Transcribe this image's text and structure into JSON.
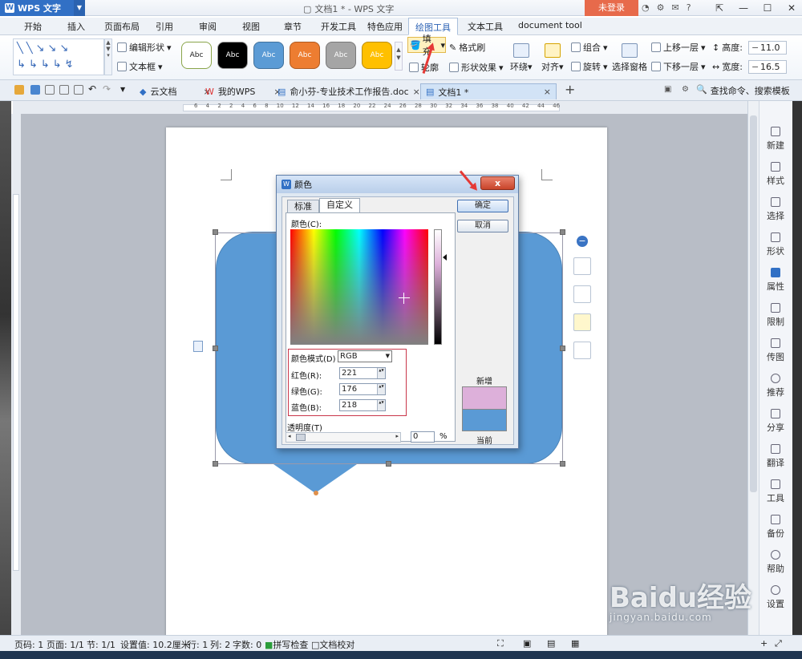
{
  "titlebar": {
    "app_name": "WPS 文字",
    "doc_title": "文档1 * - WPS 文字",
    "login": "未登录"
  },
  "menu": {
    "tabs": [
      "开始",
      "插入",
      "页面布局",
      "引用",
      "审阅",
      "视图",
      "章节",
      "开发工具",
      "特色应用",
      "绘图工具",
      "文本工具",
      "document tool"
    ],
    "active": "绘图工具"
  },
  "ribbon": {
    "edit_shape": "编辑形状",
    "textbox": "文本框",
    "style_label": "Abc",
    "fill": "填充",
    "format_painter": "格式刷",
    "outline": "轮廓",
    "shape_effects": "形状效果",
    "wrap": "环绕",
    "align": "对齐",
    "group": "组合",
    "rotate": "旋转",
    "selection_pane": "选择窗格",
    "bring_forward": "上移一层",
    "send_backward": "下移一层",
    "height_label": "高度:",
    "height_value": "11.0",
    "width_label": "宽度:",
    "width_value": "16.5",
    "style_colors": [
      "#ffffff",
      "#000000",
      "#5b9bd5",
      "#ed7d31",
      "#a5a5a5",
      "#ffc000"
    ]
  },
  "doc_tabs": {
    "items": [
      {
        "label": "云文档",
        "icon": "cloud-doc-icon"
      },
      {
        "label": "我的WPS",
        "icon": "wps-logo-icon"
      },
      {
        "label": "俞小芬-专业技术工作报告.doc",
        "icon": "doc-file-icon"
      },
      {
        "label": "文档1 *",
        "icon": "doc-file-icon"
      }
    ],
    "active": "文档1 *",
    "search": "查找命令、搜索模板"
  },
  "ruler": {
    "numbers": "6 4 2 2 4 6 8 10 12 14 16 18 20 22 24 26 28 30 32 34 36 38 40 42 44 46"
  },
  "dialog": {
    "title": "颜色",
    "close": "x",
    "tabs": [
      "标准",
      "自定义"
    ],
    "active_tab": "自定义",
    "color_label": "颜色(C):",
    "mode_label": "颜色模式(D)",
    "mode_value": "RGB",
    "red_label": "红色(R):",
    "red_value": "221",
    "green_label": "绿色(G):",
    "green_value": "176",
    "blue_label": "蓝色(B):",
    "blue_value": "218",
    "transparency_label": "透明度(T)",
    "transparency_value": "0",
    "percent": "%",
    "ok": "确定",
    "cancel": "取消",
    "new_label": "新增",
    "current_label": "当前",
    "new_color": "#ddb0da",
    "current_color": "#5a9ad5"
  },
  "sidebar": {
    "items": [
      "新建",
      "样式",
      "选择",
      "形状",
      "属性",
      "限制",
      "传图",
      "推荐",
      "分享",
      "翻译",
      "工具",
      "备份",
      "帮助",
      "设置"
    ]
  },
  "statusbar": {
    "page_num": "页码: 1",
    "pages": "页面: 1/1",
    "section": "节: 1/1",
    "setting": "设置值: 10.2厘米",
    "row": "行: 1",
    "col": "列: 2",
    "words": "字数: 0",
    "spell": "拼写检查",
    "proof": "文档校对"
  },
  "watermark": {
    "brand": "Baidu经验",
    "url": "jingyan.baidu.com"
  },
  "colors": {
    "shape_fill": "#5a9ad5",
    "accent": "#3170c5",
    "login": "#e76a4b",
    "highlight": "#c9364a"
  }
}
